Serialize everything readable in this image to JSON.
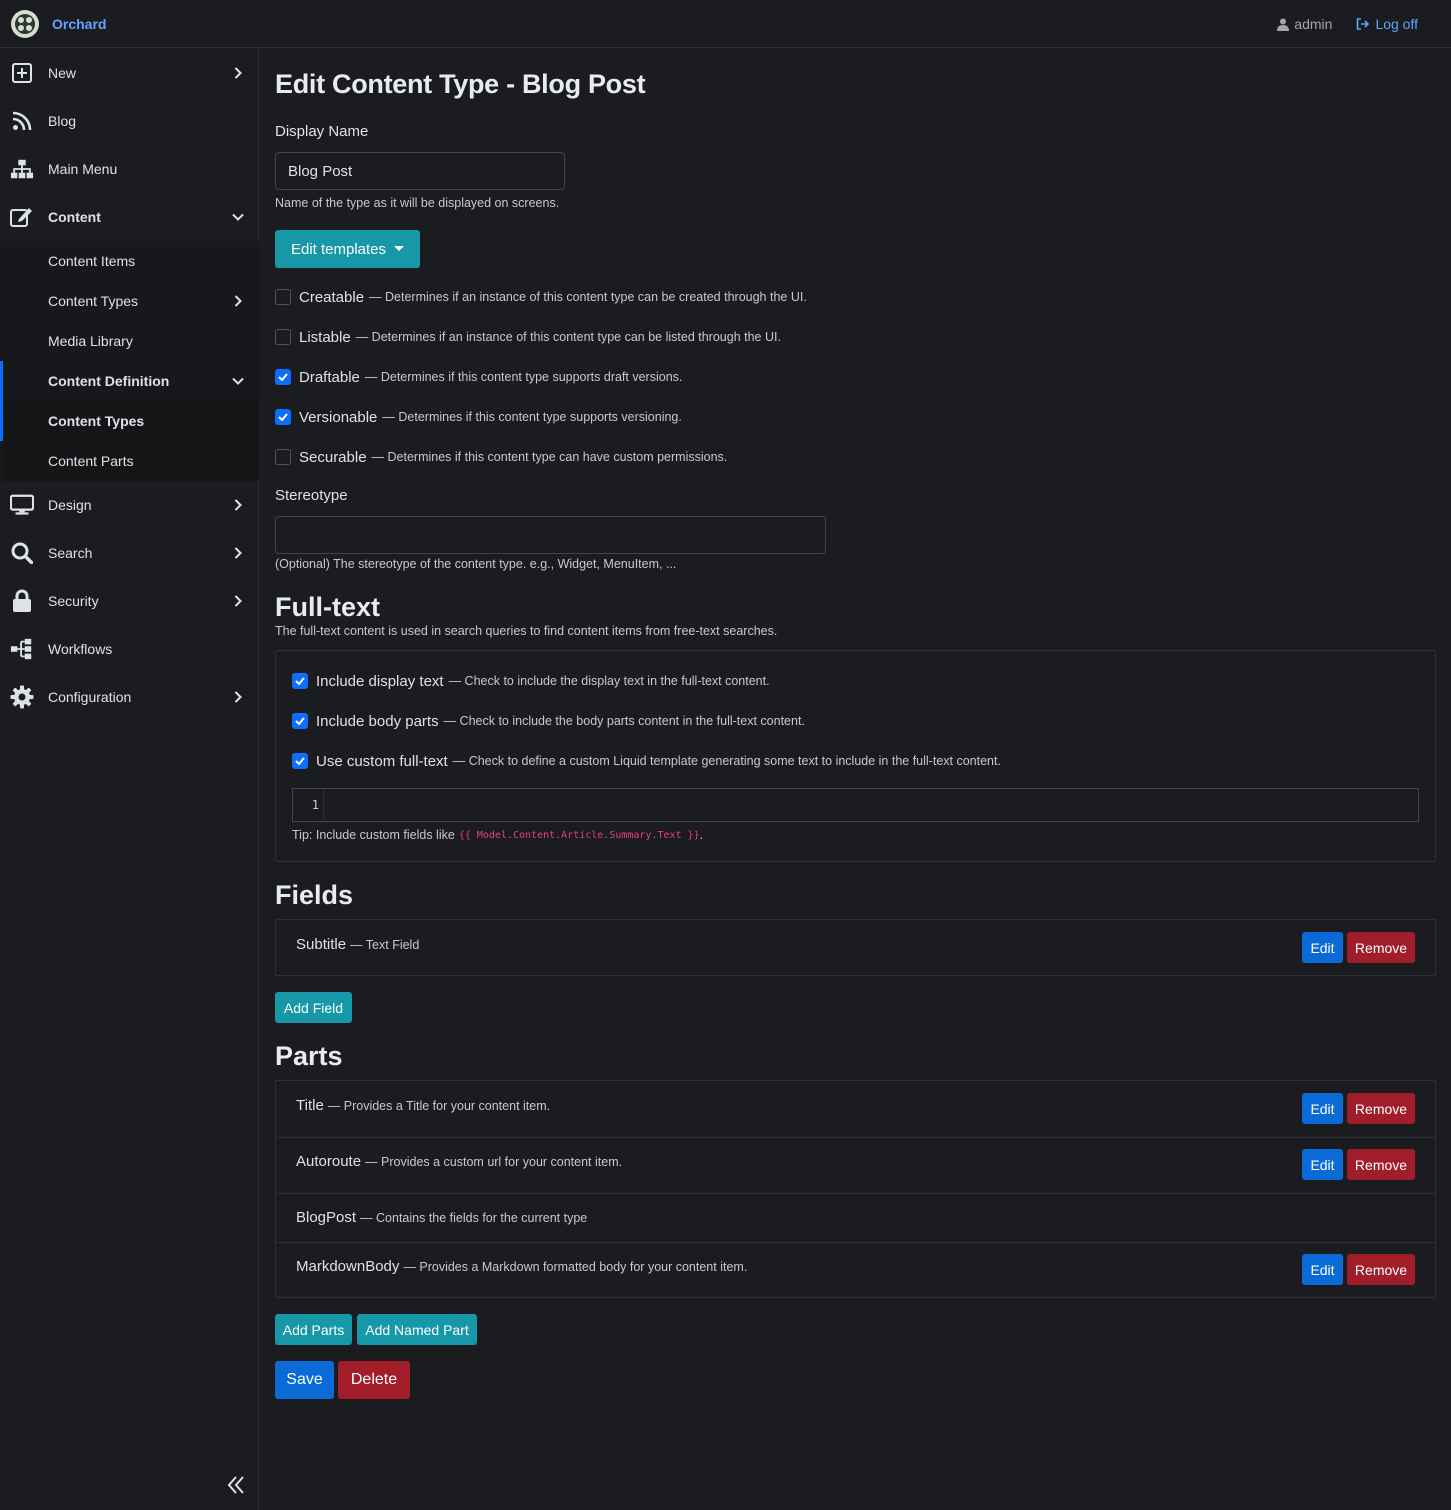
{
  "header": {
    "brand": "Orchard",
    "user": "admin",
    "logoff": "Log off"
  },
  "sidebar": {
    "items": [
      {
        "label": "New",
        "icon": "plus-square-icon",
        "chevron": "right"
      },
      {
        "label": "Blog",
        "icon": "rss-icon",
        "chevron": ""
      },
      {
        "label": "Main Menu",
        "icon": "sitemap-icon",
        "chevron": ""
      },
      {
        "label": "Content",
        "icon": "edit-icon",
        "chevron": "down"
      },
      {
        "label": "Design",
        "icon": "monitor-icon",
        "chevron": "right"
      },
      {
        "label": "Search",
        "icon": "search-icon",
        "chevron": "right"
      },
      {
        "label": "Security",
        "icon": "lock-icon",
        "chevron": "right"
      },
      {
        "label": "Workflows",
        "icon": "workflow-icon",
        "chevron": ""
      },
      {
        "label": "Configuration",
        "icon": "cog-icon",
        "chevron": "right"
      }
    ],
    "content_sub": [
      {
        "label": "Content Items"
      },
      {
        "label": "Content Types"
      },
      {
        "label": "Media Library"
      },
      {
        "label": "Content Definition"
      }
    ],
    "definition_sub": [
      {
        "label": "Content Types"
      },
      {
        "label": "Content Parts"
      }
    ]
  },
  "page": {
    "title": "Edit Content Type - Blog Post",
    "display_name_label": "Display Name",
    "display_name_value": "Blog Post",
    "display_name_help": "Name of the type as it will be displayed on screens.",
    "edit_templates": "Edit templates",
    "options": [
      {
        "label": "Creatable",
        "desc": "— Determines if an instance of this content type can be created through the UI.",
        "checked": false
      },
      {
        "label": "Listable",
        "desc": "— Determines if an instance of this content type can be listed through the UI.",
        "checked": false
      },
      {
        "label": "Draftable",
        "desc": "— Determines if this content type supports draft versions.",
        "checked": true
      },
      {
        "label": "Versionable",
        "desc": "— Determines if this content type supports versioning.",
        "checked": true
      },
      {
        "label": "Securable",
        "desc": "— Determines if this content type can have custom permissions.",
        "checked": false
      }
    ],
    "stereotype_label": "Stereotype",
    "stereotype_value": "",
    "stereotype_help": "(Optional) The stereotype of the content type. e.g., Widget, MenuItem, ...",
    "fulltext_title": "Full-text",
    "fulltext_desc": "The full-text content is used in search queries to find content items from free-text searches.",
    "fulltext_options": [
      {
        "label": "Include display text",
        "desc": "— Check to include the display text in the full-text content.",
        "checked": true
      },
      {
        "label": "Include body parts",
        "desc": "— Check to include the body parts content in the full-text content.",
        "checked": true
      },
      {
        "label": "Use custom full-text",
        "desc": "— Check to define a custom Liquid template generating some text to include in the full-text content.",
        "checked": true
      }
    ],
    "editor_line": "1",
    "tip_prefix": "Tip: Include custom fields like",
    "tip_code": "{{ Model.Content.Article.Summary.Text }}",
    "tip_suffix": ".",
    "fields_title": "Fields",
    "fields": [
      {
        "name": "Subtitle",
        "desc": "— Text Field",
        "edit": "Edit",
        "remove": "Remove"
      }
    ],
    "add_field": "Add Field",
    "parts_title": "Parts",
    "parts": [
      {
        "name": "Title",
        "desc": "— Provides a Title for your content item.",
        "edit": "Edit",
        "remove": "Remove"
      },
      {
        "name": "Autoroute",
        "desc": "— Provides a custom url for your content item.",
        "edit": "Edit",
        "remove": "Remove"
      },
      {
        "name": "BlogPost",
        "desc": "— Contains the fields for the current type"
      },
      {
        "name": "MarkdownBody",
        "desc": "— Provides a Markdown formatted body for your content item.",
        "edit": "Edit",
        "remove": "Remove"
      }
    ],
    "add_parts": "Add Parts",
    "add_named_part": "Add Named Part",
    "save": "Save",
    "delete": "Delete"
  }
}
